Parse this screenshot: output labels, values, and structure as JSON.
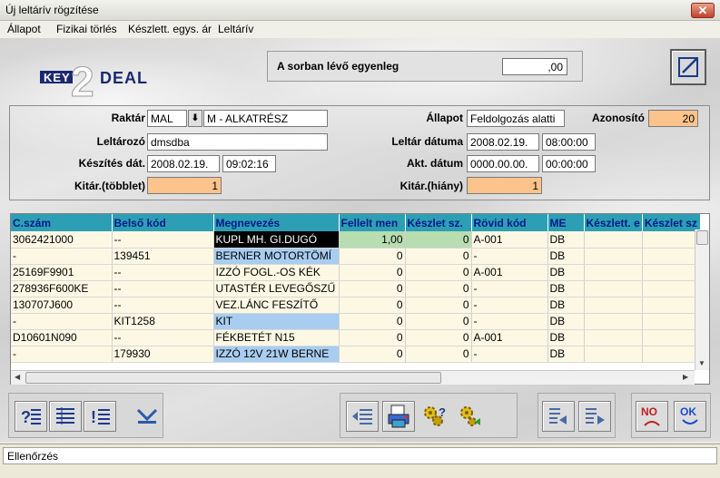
{
  "window": {
    "title": "Új leltárív rögzítése",
    "close_glyph": "✕"
  },
  "menu": [
    "Állapot",
    "Fizikai törlés",
    "Készlett. egys. ár",
    "Leltárív"
  ],
  "logo": {
    "text_left": "KEY",
    "digit": "2",
    "text_right": "DEAL"
  },
  "balance": {
    "label": "A sorban lévő egyenleg",
    "value": ",00"
  },
  "form": {
    "raktar_label": "Raktár",
    "raktar_code": "MAL",
    "raktar_name": "M - ALKATRÉSZ",
    "leltarozo_label": "Leltározó",
    "leltarozo_value": "dmsdba",
    "keszites_label": "Készítés dát.",
    "keszites_date": "2008.02.19.",
    "keszites_time": "09:02:16",
    "tobblet_label": "Kitár.(többlet)",
    "tobblet_value": "1",
    "allapot_label": "Állapot",
    "allapot_value": "Feldolgozás alatti",
    "azonosito_label": "Azonosító",
    "azonosito_value": "20",
    "leltar_datum_label": "Leltár dátuma",
    "leltar_datum_date": "2008.02.19.",
    "leltar_datum_time": "08:00:00",
    "akt_datum_label": "Akt. dátum",
    "akt_datum_date": "0000.00.00.",
    "akt_datum_time": "00:00:00",
    "hiany_label": "Kitár.(hiány)",
    "hiany_value": "1"
  },
  "table": {
    "headers": [
      "C.szám",
      "Belső kód",
      "Megnevezés",
      "Fellelt men",
      "Készlet sz.",
      "Rövid kód",
      "ME",
      "Készlett. e",
      "Készlet sz"
    ],
    "rows": [
      [
        "3062421000",
        "--",
        "KUPL MH. GI.DUGÓ",
        "1,00",
        "0",
        "A-001",
        "DB",
        "",
        ""
      ],
      [
        "-",
        "139451",
        "BERNER MOTORTÖMÍ",
        "0",
        "0",
        "-",
        "DB",
        "",
        ""
      ],
      [
        "25169F9901",
        "--",
        "IZZÓ FOGL.-OS KÉK",
        "0",
        "0",
        "A-001",
        "DB",
        "",
        ""
      ],
      [
        "278936F600KE",
        "--",
        "UTASTÉR LEVEGŐSZŰ",
        "0",
        "0",
        "-",
        "DB",
        "",
        ""
      ],
      [
        "130707J600",
        "--",
        "VEZ.LÁNC FESZÍTŐ",
        "0",
        "0",
        "-",
        "DB",
        "",
        ""
      ],
      [
        "-",
        "KIT1258",
        "KIT",
        "0",
        "0",
        "-",
        "DB",
        "",
        ""
      ],
      [
        "D10601N090",
        "--",
        "FÉKBETÉT N15",
        "0",
        "0",
        "A-001",
        "DB",
        "",
        ""
      ],
      [
        "-",
        "179930",
        "IZZÓ 12V 21W BERNE",
        "0",
        "0",
        "-",
        "DB",
        "",
        ""
      ]
    ]
  },
  "toolbar": {
    "no_label": "NO",
    "ok_label": "OK"
  },
  "status": {
    "text": "Ellenőrzés"
  }
}
